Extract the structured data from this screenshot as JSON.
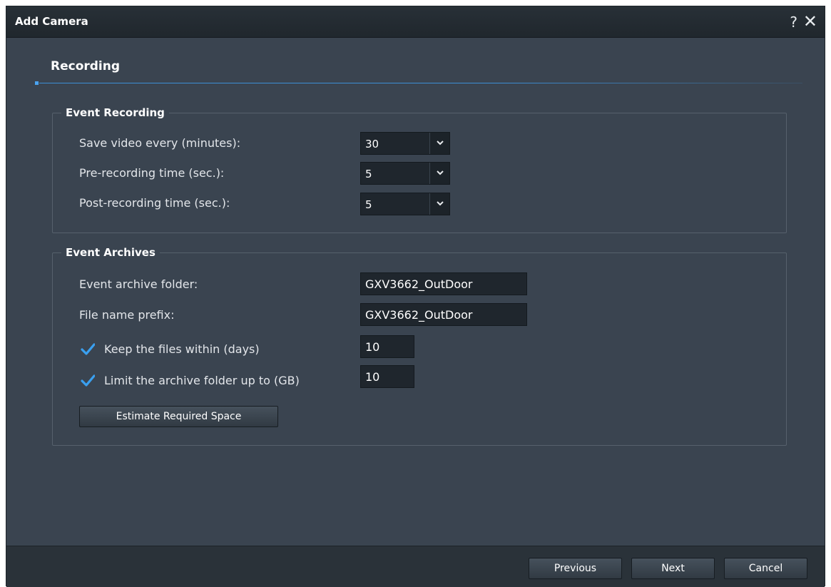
{
  "window": {
    "title": "Add Camera",
    "help_glyph": "?",
    "close_glyph": "✕"
  },
  "step": {
    "title": "Recording"
  },
  "event_recording": {
    "legend": "Event Recording",
    "save_video_label": "Save video every (minutes):",
    "save_video_value": "30",
    "pre_recording_label": "Pre-recording time (sec.):",
    "pre_recording_value": "5",
    "post_recording_label": "Post-recording time (sec.):",
    "post_recording_value": "5"
  },
  "event_archives": {
    "legend": "Event Archives",
    "folder_label": "Event archive folder:",
    "folder_value": "GXV3662_OutDoor",
    "prefix_label": "File name prefix:",
    "prefix_value": "GXV3662_OutDoor",
    "keep_files_label": "Keep the files within (days)",
    "keep_files_checked": true,
    "keep_files_value": "10",
    "limit_label": "Limit the archive folder up to (GB)",
    "limit_checked": true,
    "limit_value": "10",
    "estimate_button": "Estimate Required Space"
  },
  "footer": {
    "previous": "Previous",
    "next": "Next",
    "cancel": "Cancel"
  },
  "colors": {
    "accent": "#3d8fd6",
    "check": "#3aa0f0",
    "background": "#3a4450"
  },
  "icons": {
    "help": "question-mark-icon",
    "close": "close-icon",
    "dropdown": "chevron-down-icon",
    "checkbox": "checkmark-icon"
  }
}
